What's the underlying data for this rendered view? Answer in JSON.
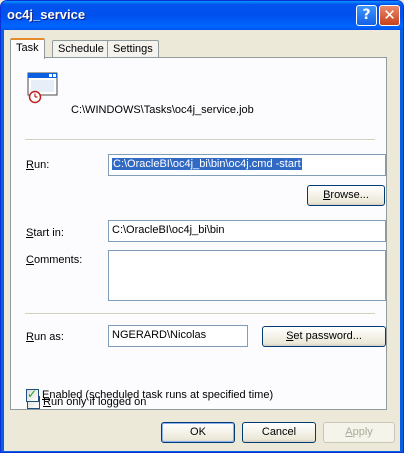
{
  "window": {
    "title": "oc4j_service",
    "help_glyph": "?",
    "close_glyph": "✕"
  },
  "tabs": [
    {
      "label": "Task",
      "active": true
    },
    {
      "label": "Schedule",
      "active": false
    },
    {
      "label": "Settings",
      "active": false
    }
  ],
  "task": {
    "job_path": "C:\\WINDOWS\\Tasks\\oc4j_service.job",
    "run": {
      "label_first": "R",
      "label_rest": "un:",
      "value": "C:\\OracleBI\\oc4j_bi\\bin\\oc4j.cmd -start"
    },
    "browse_button": {
      "first": "B",
      "rest": "rowse..."
    },
    "start_in": {
      "label_first": "S",
      "label_rest": "tart in:",
      "value": "C:\\OracleBI\\oc4j_bi\\bin"
    },
    "comments": {
      "label_first": "C",
      "label_rest": "omments:",
      "value": ""
    },
    "run_as": {
      "label_first": "R",
      "label_rest": "un as:",
      "value": "NGERARD\\Nicolas"
    },
    "set_password_button": {
      "first": "S",
      "rest": "et password..."
    },
    "run_only_logged_on": {
      "first": "R",
      "rest": "un only if logged on",
      "checked": false
    },
    "enabled": {
      "first": "E",
      "rest": "nabled (scheduled task runs at specified time)",
      "checked": true
    }
  },
  "footer": {
    "ok": "OK",
    "cancel": "Cancel",
    "apply_first": "A",
    "apply_rest": "pply"
  },
  "icons": [
    "help-icon",
    "close-icon",
    "scheduled-task-icon",
    "checkmark-icon"
  ],
  "colors": {
    "titlebar": "#0053ee",
    "selection": "#316ac5",
    "tab_highlight": "#e68b2c",
    "dialog_bg": "#ece9d8"
  }
}
